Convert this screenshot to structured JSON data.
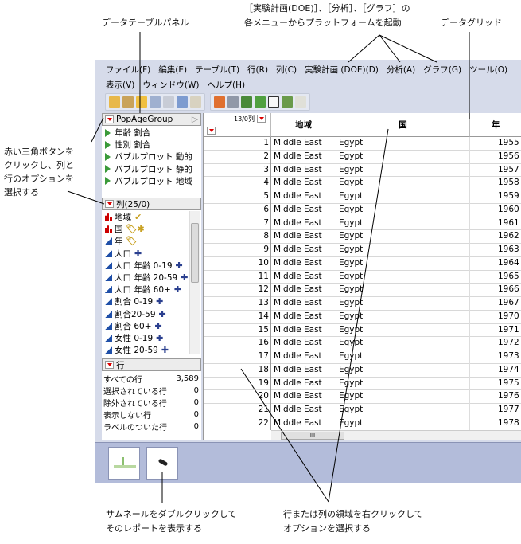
{
  "annotations": {
    "data_table_panel": "データテーブルパネル",
    "launch_line1": "［実験計画(DOE)］、［分析］、［グラフ］の",
    "launch_line2": "各メニューからプラットフォームを起動",
    "data_grid": "データグリッド",
    "red_tri_1": "赤い三角ボタンを",
    "red_tri_2": "クリックし、列と",
    "red_tri_3": "行のオプションを",
    "red_tri_4": "選択する",
    "thumb_1": "サムネールをダブルクリックして",
    "thumb_2": "そのレポートを表示する",
    "rightclick_1": "行または列の領域を右クリックして",
    "rightclick_2": "オプションを選択する"
  },
  "menu": {
    "row1": [
      "ファイル(F)",
      "編集(E)",
      "テーブル(T)",
      "行(R)",
      "列(C)",
      "実験計画 (DOE)(D)",
      "分析(A)",
      "グラフ(G)",
      "ツール(O)"
    ],
    "row2": [
      "表示(V)",
      "ウィンドウ(W)",
      "ヘルプ(H)"
    ]
  },
  "table_panel": {
    "title": "PopAgeGroup",
    "scripts": [
      "年齢 割合",
      "性別 割合",
      "バブルプロット 動的",
      "バブルプロット 静的",
      "バブルプロット 地域"
    ]
  },
  "columns_panel": {
    "title": "列(25/0)",
    "columns": [
      {
        "name": "地域",
        "type": "nominal",
        "badge": "✔"
      },
      {
        "name": "国",
        "type": "nominal",
        "badge": "🏷✱"
      },
      {
        "name": "年",
        "type": "continuous",
        "badge": "🏷"
      },
      {
        "name": "人口",
        "type": "continuous",
        "badge": "✚"
      },
      {
        "name": "人口 年齢 0-19",
        "type": "continuous",
        "badge": "✚"
      },
      {
        "name": "人口 年齢 20-59",
        "type": "continuous",
        "badge": "✚"
      },
      {
        "name": "人口 年齢 60+",
        "type": "continuous",
        "badge": "✚"
      },
      {
        "name": "割合 0-19",
        "type": "continuous",
        "badge": "✚"
      },
      {
        "name": "割合20-59",
        "type": "continuous",
        "badge": "✚"
      },
      {
        "name": "割合 60+",
        "type": "continuous",
        "badge": "✚"
      },
      {
        "name": "女性 0-19",
        "type": "continuous",
        "badge": "✚"
      },
      {
        "name": "女性 20-59",
        "type": "continuous",
        "badge": "✚"
      }
    ]
  },
  "rows_panel": {
    "title": "行",
    "stats": [
      {
        "label": "すべての行",
        "value": "3,589"
      },
      {
        "label": "選択されている行",
        "value": "0"
      },
      {
        "label": "除外されている行",
        "value": "0"
      },
      {
        "label": "表示しない行",
        "value": "0"
      },
      {
        "label": "ラベルのついた行",
        "value": "0"
      }
    ]
  },
  "grid": {
    "col_count": "13/0列",
    "headers": [
      "地域",
      "国",
      "年"
    ],
    "rows": [
      [
        "1",
        "Middle East",
        "Egypt",
        "1955"
      ],
      [
        "2",
        "Middle East",
        "Egypt",
        "1956"
      ],
      [
        "3",
        "Middle East",
        "Egypt",
        "1957"
      ],
      [
        "4",
        "Middle East",
        "Egypt",
        "1958"
      ],
      [
        "5",
        "Middle East",
        "Egypt",
        "1959"
      ],
      [
        "6",
        "Middle East",
        "Egypt",
        "1960"
      ],
      [
        "7",
        "Middle East",
        "Egypt",
        "1961"
      ],
      [
        "8",
        "Middle East",
        "Egypt",
        "1962"
      ],
      [
        "9",
        "Middle East",
        "Egypt",
        "1963"
      ],
      [
        "10",
        "Middle East",
        "Egypt",
        "1964"
      ],
      [
        "11",
        "Middle East",
        "Egypt",
        "1965"
      ],
      [
        "12",
        "Middle East",
        "Egypt",
        "1966"
      ],
      [
        "13",
        "Middle East",
        "Egypt",
        "1967"
      ],
      [
        "14",
        "Middle East",
        "Egypt",
        "1970"
      ],
      [
        "15",
        "Middle East",
        "Egypt",
        "1971"
      ],
      [
        "16",
        "Middle East",
        "Egypt",
        "1972"
      ],
      [
        "17",
        "Middle East",
        "Egypt",
        "1973"
      ],
      [
        "18",
        "Middle East",
        "Egypt",
        "1974"
      ],
      [
        "19",
        "Middle East",
        "Egypt",
        "1975"
      ],
      [
        "20",
        "Middle East",
        "Egypt",
        "1976"
      ],
      [
        "21",
        "Middle East",
        "Egypt",
        "1977"
      ],
      [
        "22",
        "Middle East",
        "Egypt",
        "1978"
      ]
    ]
  }
}
